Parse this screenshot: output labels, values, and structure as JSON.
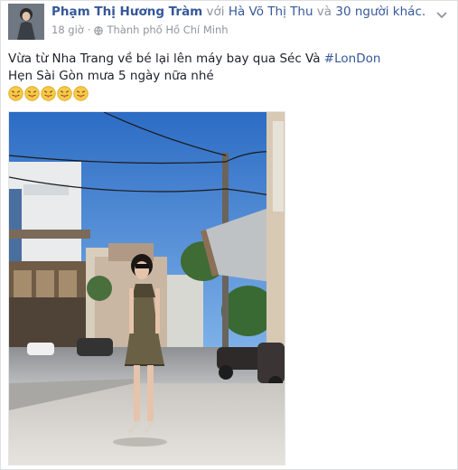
{
  "post": {
    "author": "Phạm Thị Hương Tràm",
    "with_text": "với",
    "tagged_name": "Hà Võ Thị Thu",
    "and_text": "và",
    "others": "30 người khác.",
    "time": "18 giờ",
    "dot": "·",
    "location": "Thành phố Hồ Chí Minh",
    "text_line1_plain": "Vừa từ Nha Trang về bé lại lên máy bay qua Séc Và ",
    "text_line1_hashtag": "#LonDon",
    "text_line2": "Hẹn Sài Gòn mưa 5 ngày nữa nhé",
    "emoji_count": 5,
    "emoji_name": "tongue-out-face-icon"
  },
  "icons": {
    "globe": "globe-icon",
    "menu": "chevron-down-icon"
  },
  "colors": {
    "link": "#365899",
    "meta": "#90949c",
    "text": "#1d2129",
    "sky": "#3d7fd0"
  }
}
